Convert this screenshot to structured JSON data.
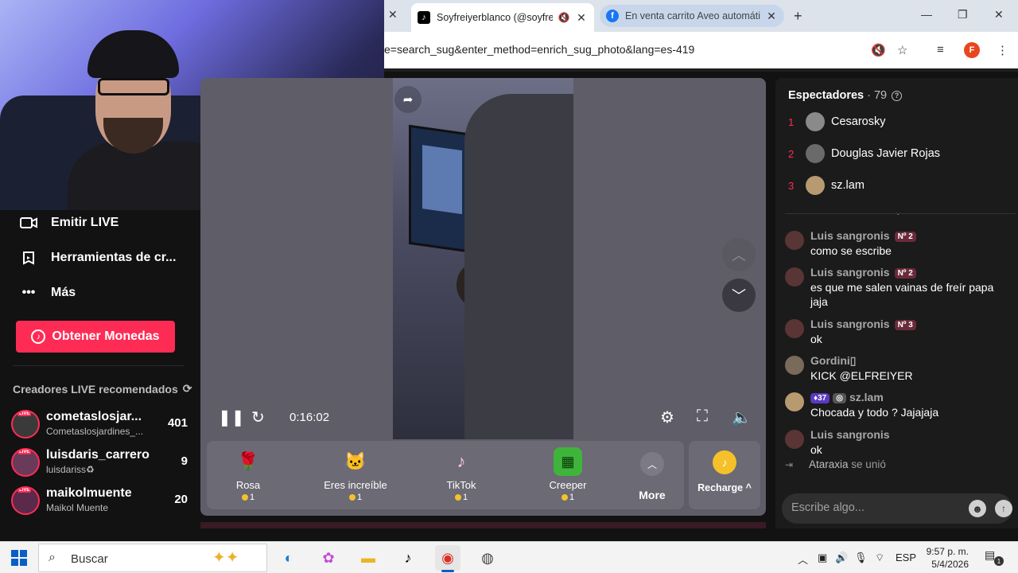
{
  "browser": {
    "tab_left_close": "✕",
    "active_tab": {
      "icon": "tiktok-icon",
      "title": "Soyfreiyerblanco (@soyfreiy"
    },
    "inactive_tab": {
      "icon": "facebook-icon",
      "title": "En venta carrito Aveo automátic"
    },
    "new_tab": "+",
    "url": "e=search_sug&enter_method=enrich_sug_photo&lang=es-419",
    "profile_initial": "F"
  },
  "sidebar": {
    "items": [
      {
        "icon": "video-camera-icon",
        "label": "Emitir LIVE"
      },
      {
        "icon": "tools-icon",
        "label": "Herramientas de cr..."
      },
      {
        "icon": "more-dots-icon",
        "label": "Más"
      }
    ],
    "coins_button": "Obtener Monedas",
    "section_title": "Creadores LIVE recomendados",
    "creators": [
      {
        "name": "cometaslosjar...",
        "sub": "Cometaslosjardines_...",
        "count": "401"
      },
      {
        "name": "luisdaris_carrero",
        "sub": "luisdariss♻",
        "count": "9"
      },
      {
        "name": "maikolmuente",
        "sub": "Maikol Muente",
        "count": "20"
      }
    ]
  },
  "player": {
    "time": "0:16:02",
    "gifts": [
      {
        "name": "Rosa",
        "price": "1",
        "icon": "🌹"
      },
      {
        "name": "Eres increíble",
        "price": "1",
        "icon": "🐱"
      },
      {
        "name": "TikTok",
        "price": "1",
        "icon": "♪"
      },
      {
        "name": "Creeper",
        "price": "1",
        "icon": "▦"
      }
    ],
    "more_label": "More",
    "recharge_label": "Recharge ^"
  },
  "chat": {
    "viewers_title": "Espectadores",
    "viewers_count": " · 79",
    "top_viewers": [
      {
        "rank": "1",
        "name": "Cesarosky"
      },
      {
        "rank": "2",
        "name": "Douglas Javier Rojas"
      },
      {
        "rank": "3",
        "name": "sz.lam"
      }
    ],
    "messages": [
      {
        "user": "Luis sangronis",
        "badge": "Nº 2",
        "text": "como se escribe"
      },
      {
        "user": "Luis sangronis",
        "badge": "Nº 2",
        "text": "es que me salen vainas de freír papa jaja"
      },
      {
        "user": "Luis sangronis",
        "badge": "Nº 3",
        "text": "ok"
      },
      {
        "user": "Gordini▯",
        "badge": "",
        "text": "KICK @ELFREIYER"
      },
      {
        "user": "sz.lam",
        "level": "37",
        "text": "Chocada y todo ? Jajajaja"
      },
      {
        "user": "Luis sangronis",
        "badge": "",
        "text": "ok"
      }
    ],
    "joined": {
      "user": "Ataraxia",
      "action": "se unió"
    },
    "input_placeholder": "Escribe algo..."
  },
  "taskbar": {
    "search_placeholder": "Buscar",
    "language": "ESP",
    "time": "9:57 p. m.",
    "date": "5/4/2026",
    "notification_count": "1"
  },
  "colors": {
    "accent": "#fe2c55",
    "coin": "#f5c02a",
    "player_bg": "#5e5d68"
  }
}
